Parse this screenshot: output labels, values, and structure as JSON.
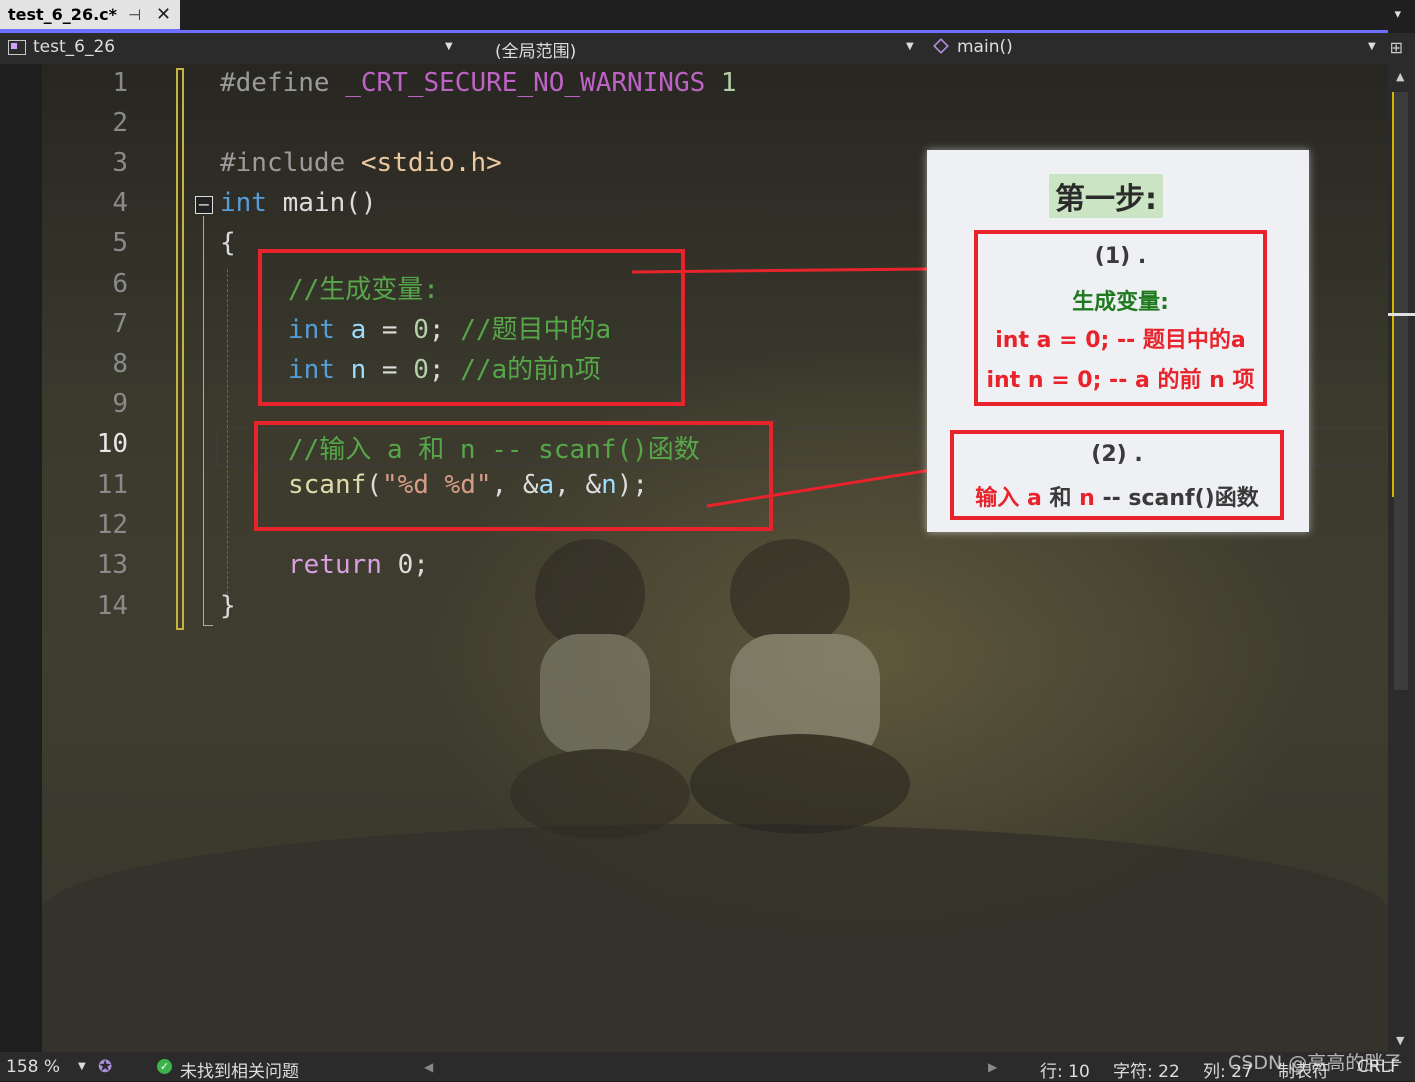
{
  "tab": {
    "title": "test_6_26.c*",
    "pin": "⊣",
    "close": "✕",
    "overflow": "▾"
  },
  "navbar": {
    "project": "test_6_26",
    "scope": "(全局范围)",
    "member": "main()",
    "split": "⊞"
  },
  "editor": {
    "line_numbers": [
      "1",
      "2",
      "3",
      "4",
      "5",
      "6",
      "7",
      "8",
      "9",
      "10",
      "11",
      "12",
      "13",
      "14"
    ],
    "current_line": "10",
    "fold_toggle": "−",
    "lines": [
      {
        "t1": "#define ",
        "t2": "_CRT_SECURE_NO_WARNINGS",
        "t3": " 1"
      },
      {},
      {
        "t1": "#include ",
        "t2": "<stdio.h>"
      },
      {
        "t1": "int",
        "t2": " main()"
      },
      {
        "t1": "{"
      },
      {
        "t1": "//生成变量:"
      },
      {
        "t1": "int",
        "t2": " a",
        "t3": " = ",
        "t4": "0",
        "t5": "; ",
        "t6": "//题目中的a"
      },
      {
        "t1": "int",
        "t2": " n",
        "t3": " = ",
        "t4": "0",
        "t5": "; ",
        "t6": "//a的前n项"
      },
      {},
      {
        "t1": "//输入 a 和 n -- scanf()函数"
      },
      {
        "t1": "scanf",
        "t2": "(",
        "t3": "\"%d %d\"",
        "t4": ", &",
        "t5": "a",
        "t6": ", &",
        "t7": "n",
        "t8": ");"
      },
      {},
      {
        "t1": "return",
        "t2": " 0;"
      },
      {
        "t1": "}"
      }
    ]
  },
  "annotation": {
    "title": "第一步:",
    "step1": {
      "label": "(1) .",
      "heading": "生成变量:",
      "line1_code": "int a = 0; -- ",
      "line1_text": "题目中的a",
      "line2_code": "int n = 0; -- ",
      "line2_text": "a 的前 n 项"
    },
    "step2": {
      "label": "(2) .",
      "t1": "输入 ",
      "t2": "a",
      "t3": " 和 ",
      "t4": "n",
      "t5": " -- scanf()函数"
    }
  },
  "statusbar": {
    "zoom": "158 %",
    "issues": "未找到相关问题",
    "line": "行: 10",
    "char": "字符: 22",
    "col": "列: 27",
    "tabs": "制表符",
    "eol": "CRLF"
  },
  "watermark": "CSDN @高高的胖子",
  "colors": {
    "accent": "#6e6eff",
    "box_red": "#e8232b",
    "comment_green": "#57a64a",
    "keyword_blue": "#569cd6"
  }
}
